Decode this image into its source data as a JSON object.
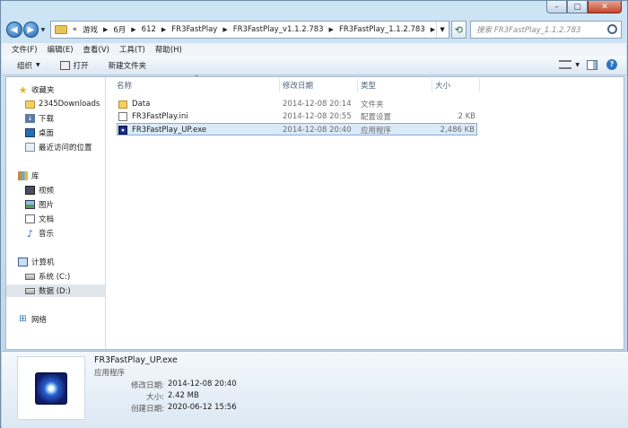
{
  "window": {
    "caption": {
      "minimize": "–",
      "maximize": "▢",
      "close": "✕"
    }
  },
  "nav": {
    "back_icon": "◀",
    "forward_icon": "▶",
    "breadcrumb_overflow": "«",
    "breadcrumbs": [
      "游戏",
      "6月",
      "612",
      "FR3FastPlay",
      "FR3FastPlay_v1.1.2.783",
      "FR3FastPlay_1.1.2.783"
    ],
    "search_placeholder": "搜索 FR3FastPlay_1.1.2.783"
  },
  "menu": [
    "文件(F)",
    "编辑(E)",
    "查看(V)",
    "工具(T)",
    "帮助(H)"
  ],
  "toolbar": {
    "organize": "组织",
    "open": "打开",
    "new_folder": "新建文件夹"
  },
  "sidebar": {
    "favorites": "收藏夹",
    "favorite_items": [
      "2345Downloads",
      "下载",
      "桌面",
      "最近访问的位置"
    ],
    "libraries": "库",
    "library_items": [
      "视频",
      "图片",
      "文档",
      "音乐"
    ],
    "computer": "计算机",
    "computer_items": [
      "系统 (C:)",
      "数据 (D:)"
    ],
    "network": "网络"
  },
  "columns": {
    "name": "名称",
    "date": "修改日期",
    "type": "类型",
    "size": "大小"
  },
  "files": [
    {
      "name": "Data",
      "date": "2014-12-08 20:14",
      "type": "文件夹",
      "size": "",
      "icon": "folder-icon"
    },
    {
      "name": "FR3FastPlay.ini",
      "date": "2014-12-08 20:55",
      "type": "配置设置",
      "size": "2 KB",
      "icon": "settings-file-icon"
    },
    {
      "name": "FR3FastPlay_UP.exe",
      "date": "2014-12-08 20:40",
      "type": "应用程序",
      "size": "2,486 KB",
      "icon": "exe-icon"
    }
  ],
  "details": {
    "name": "FR3FastPlay_UP.exe",
    "type": "应用程序",
    "modified_label": "修改日期:",
    "modified_value": "2014-12-08 20:40",
    "size_label": "大小:",
    "size_value": "2.42 MB",
    "created_label": "创建日期:",
    "created_value": "2020-06-12 15:56"
  },
  "colors": {
    "selection": "#dbeaf8",
    "selection_border": "#84acd6",
    "chrome": "#cde4f5"
  }
}
